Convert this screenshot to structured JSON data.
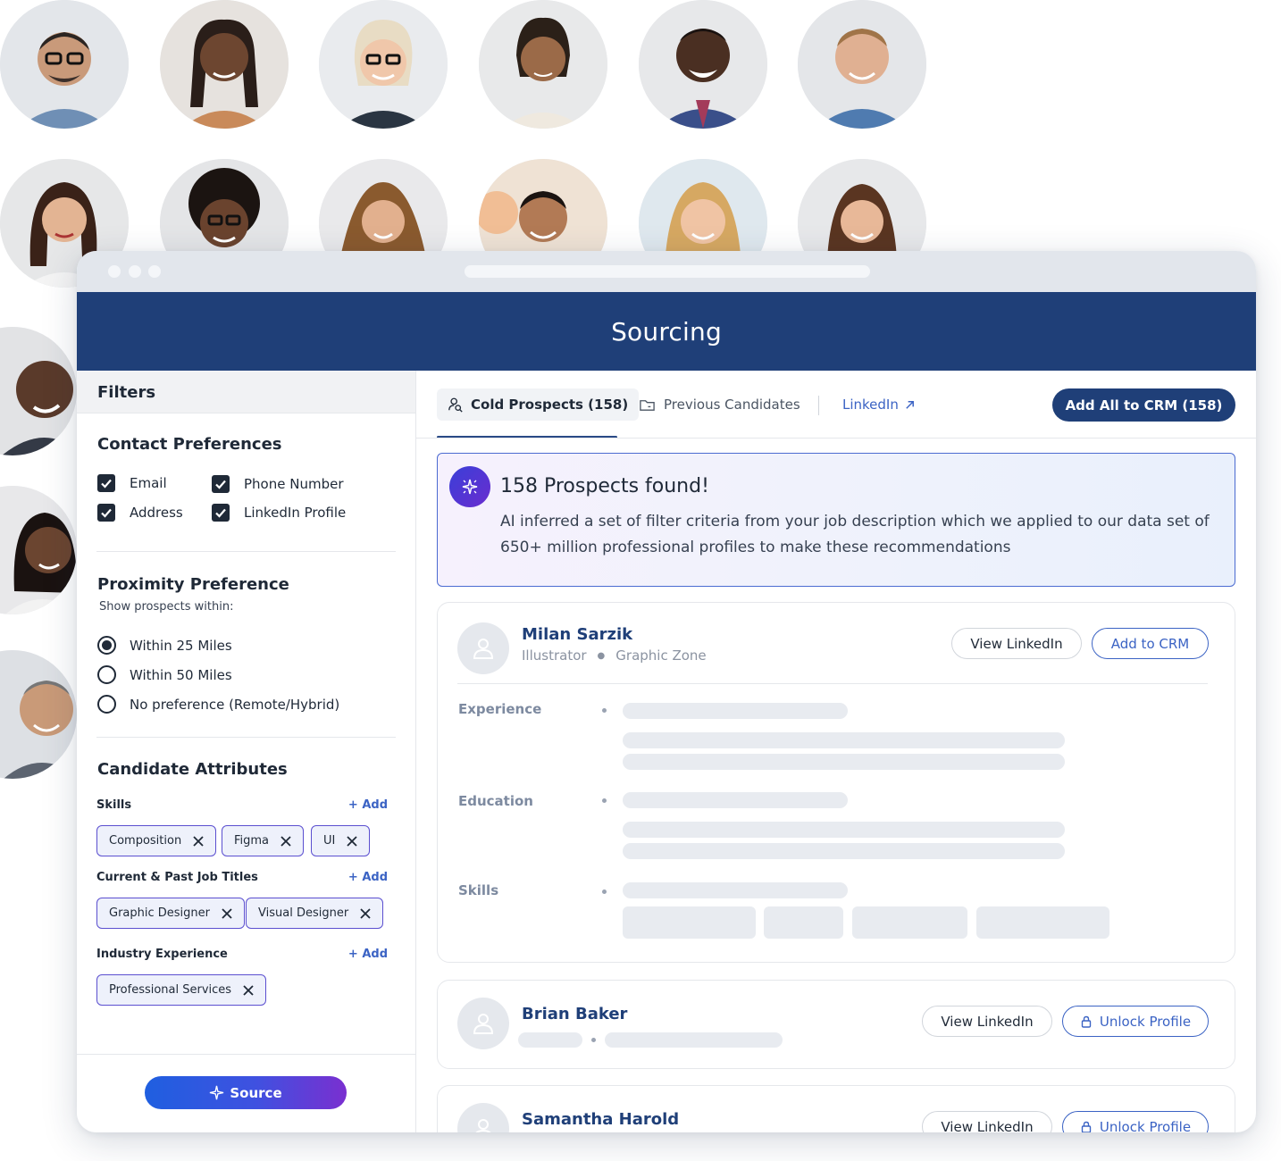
{
  "app": {
    "title": "Sourcing"
  },
  "avatars": [
    "avatar-1",
    "avatar-2",
    "avatar-3",
    "avatar-4",
    "avatar-5",
    "avatar-6",
    "avatar-7",
    "avatar-8",
    "avatar-9",
    "avatar-10",
    "avatar-11",
    "avatar-12",
    "avatar-13",
    "avatar-14",
    "avatar-15"
  ],
  "filters": {
    "heading": "Filters",
    "contact": {
      "title": "Contact Preferences",
      "options": [
        {
          "label": "Email",
          "checked": true
        },
        {
          "label": "Phone Number",
          "checked": true
        },
        {
          "label": "Address",
          "checked": true
        },
        {
          "label": "LinkedIn Profile",
          "checked": true
        }
      ]
    },
    "proximity": {
      "title": "Proximity Preference",
      "subtitle": "Show prospects within:",
      "options": [
        {
          "label": "Within 25 Miles",
          "selected": true
        },
        {
          "label": "Within 50 Miles",
          "selected": false
        },
        {
          "label": "No preference (Remote/Hybrid)",
          "selected": false
        }
      ]
    },
    "attributes": {
      "title": "Candidate Attributes",
      "add_label": "+ Add",
      "skills": {
        "label": "Skills",
        "chips": [
          "Composition",
          "Figma",
          "UI"
        ]
      },
      "job_titles": {
        "label": "Current & Past Job Titles",
        "chips": [
          "Graphic Designer",
          "Visual Designer"
        ]
      },
      "industry": {
        "label": "Industry Experience",
        "chips": [
          "Professional Services"
        ]
      }
    },
    "source_button": "Source"
  },
  "results": {
    "tabs": {
      "cold": "Cold Prospects (158)",
      "previous": "Previous Candidates",
      "linkedin": "LinkedIn"
    },
    "add_all_button": "Add All to CRM (158)",
    "notice": {
      "title": "158 Prospects found!",
      "body": "AI inferred a set of filter criteria from your job description which we applied to our data set of 650+ million professional profiles to make these recommendations"
    },
    "candidates": [
      {
        "name": "Milan Sarzik",
        "role": "Illustrator",
        "company": "Graphic Zone",
        "primary_action": "View LinkedIn",
        "secondary_action": "Add to CRM",
        "fields": [
          "Experience",
          "Education",
          "Skills"
        ]
      },
      {
        "name": "Brian Baker",
        "primary_action": "View LinkedIn",
        "secondary_action": "Unlock Profile"
      },
      {
        "name": "Samantha Harold",
        "primary_action": "View LinkedIn",
        "secondary_action": "Unlock Profile"
      }
    ]
  },
  "colors": {
    "brand_navy": "#1f3f78",
    "link_blue": "#3b63c4",
    "chip_border": "#5b4fd0",
    "source_gradient_start": "#1f5fe0",
    "source_gradient_end": "#7a2fd0"
  }
}
